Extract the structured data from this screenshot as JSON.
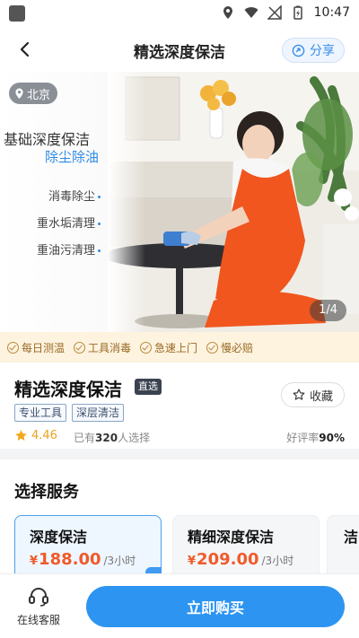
{
  "status_bar": {
    "time": "10:47"
  },
  "navbar": {
    "title": "精选深度保洁",
    "share_label": "分享"
  },
  "hero": {
    "city": "北京",
    "heading": "基础深度保洁",
    "subheading": "除尘除油",
    "features": [
      "消毒除尘",
      "重水垢清理",
      "重油污清理"
    ],
    "page_indicator": "1/4"
  },
  "guarantees": [
    "每日测温",
    "工具消毒",
    "急速上门",
    "慢必赔"
  ],
  "product": {
    "title": "精选深度保洁",
    "badge": "直选",
    "favorite_label": "收藏",
    "tags": [
      "专业工具",
      "深层清洁"
    ],
    "rating": "4.46",
    "sold_prefix": "已有",
    "sold_count": "320",
    "sold_suffix": "人选择",
    "good_rate_label": "好评率",
    "good_rate_value": "90%"
  },
  "services": {
    "title": "选择服务",
    "options": [
      {
        "name": "深度保洁",
        "currency": "¥",
        "price": "188.00",
        "unit": "/3小时",
        "selected": true
      },
      {
        "name": "精细深度保洁",
        "currency": "¥",
        "price": "209.00",
        "unit": "/3小时",
        "selected": false
      }
    ],
    "third_option_partial": "洁"
  },
  "bottom_bar": {
    "customer_service_label": "在线客服",
    "buy_label": "立即购买"
  },
  "colors": {
    "accent": "#2d95f1",
    "price": "#f05a2a",
    "guarantee_bg": "#fdf3df"
  }
}
